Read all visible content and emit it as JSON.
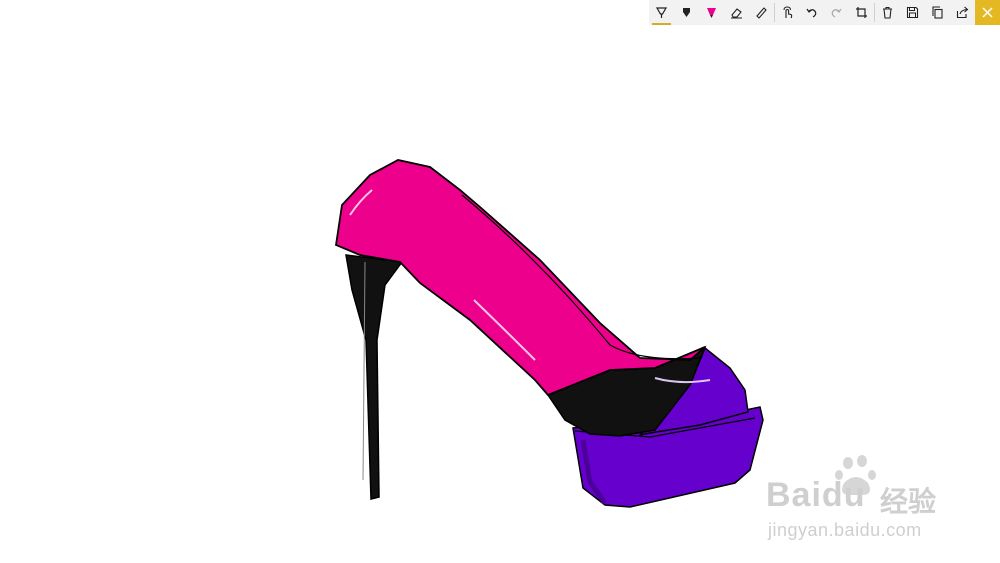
{
  "toolbar": {
    "accent": "#d4ad2c",
    "close_bg": "#e3b823",
    "groups": [
      [
        "ballpoint-pen-icon",
        "pencil-icon",
        "highlighter-icon",
        "eraser-icon",
        "ruler-icon"
      ],
      [
        "touch-writing-icon",
        "undo-icon",
        "redo-icon",
        "crop-icon"
      ],
      [
        "delete-icon",
        "save-icon",
        "copy-icon",
        "share-icon"
      ]
    ],
    "close_icon": "close-icon"
  },
  "drawing": {
    "subject": "high-heel-shoe-sketch",
    "colors": {
      "upper": "#ec008c",
      "platform": "#6600cc",
      "heel": "#111111",
      "outline": "#000000"
    }
  },
  "watermark": {
    "brand": "Bai",
    "brand_tail": "du",
    "cn": "经验",
    "url": "jingyan.baidu.com"
  }
}
